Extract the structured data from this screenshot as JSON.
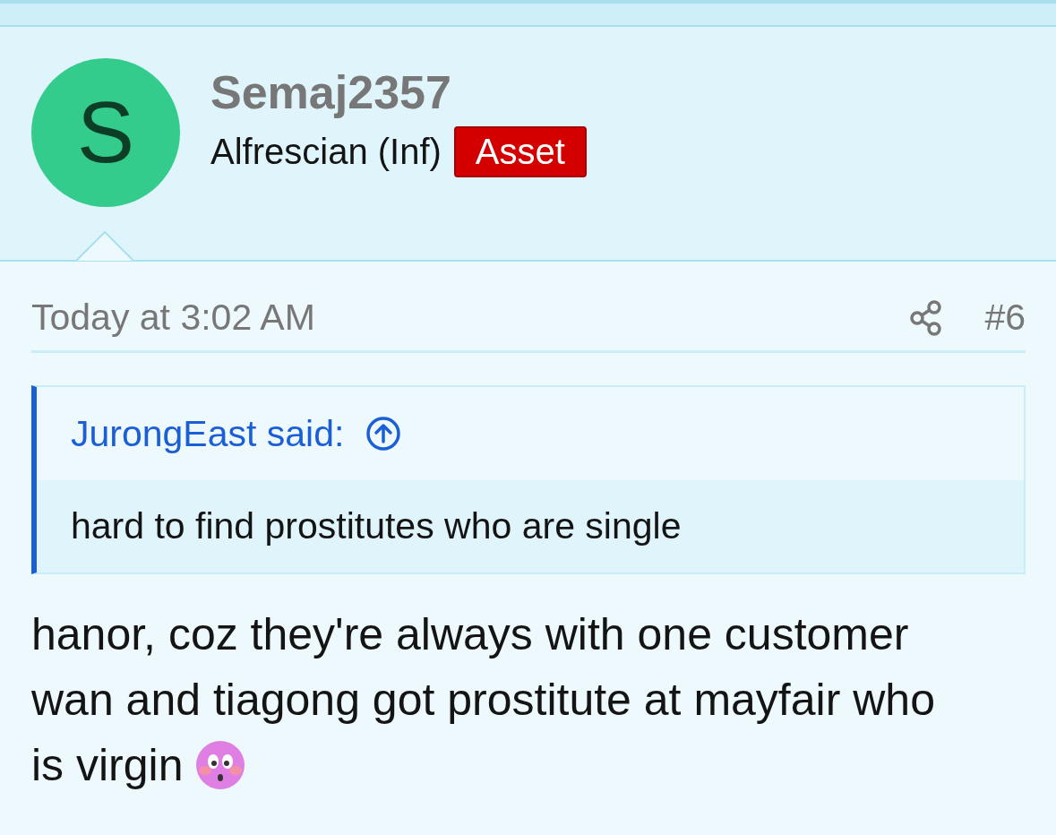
{
  "post": {
    "author": {
      "avatar_letter": "S",
      "name": "Semaj2357",
      "title": "Alfrescian (Inf)",
      "badge": "Asset"
    },
    "date": "Today at 3:02 AM",
    "post_number": "#6",
    "quote": {
      "author_line": "JurongEast said:",
      "text": "hard to find prostitutes who are single"
    },
    "message_lines": [
      "hanor, coz they're always with one customer",
      "wan and tiagong got prostitute at mayfair who",
      "is virgin"
    ]
  }
}
